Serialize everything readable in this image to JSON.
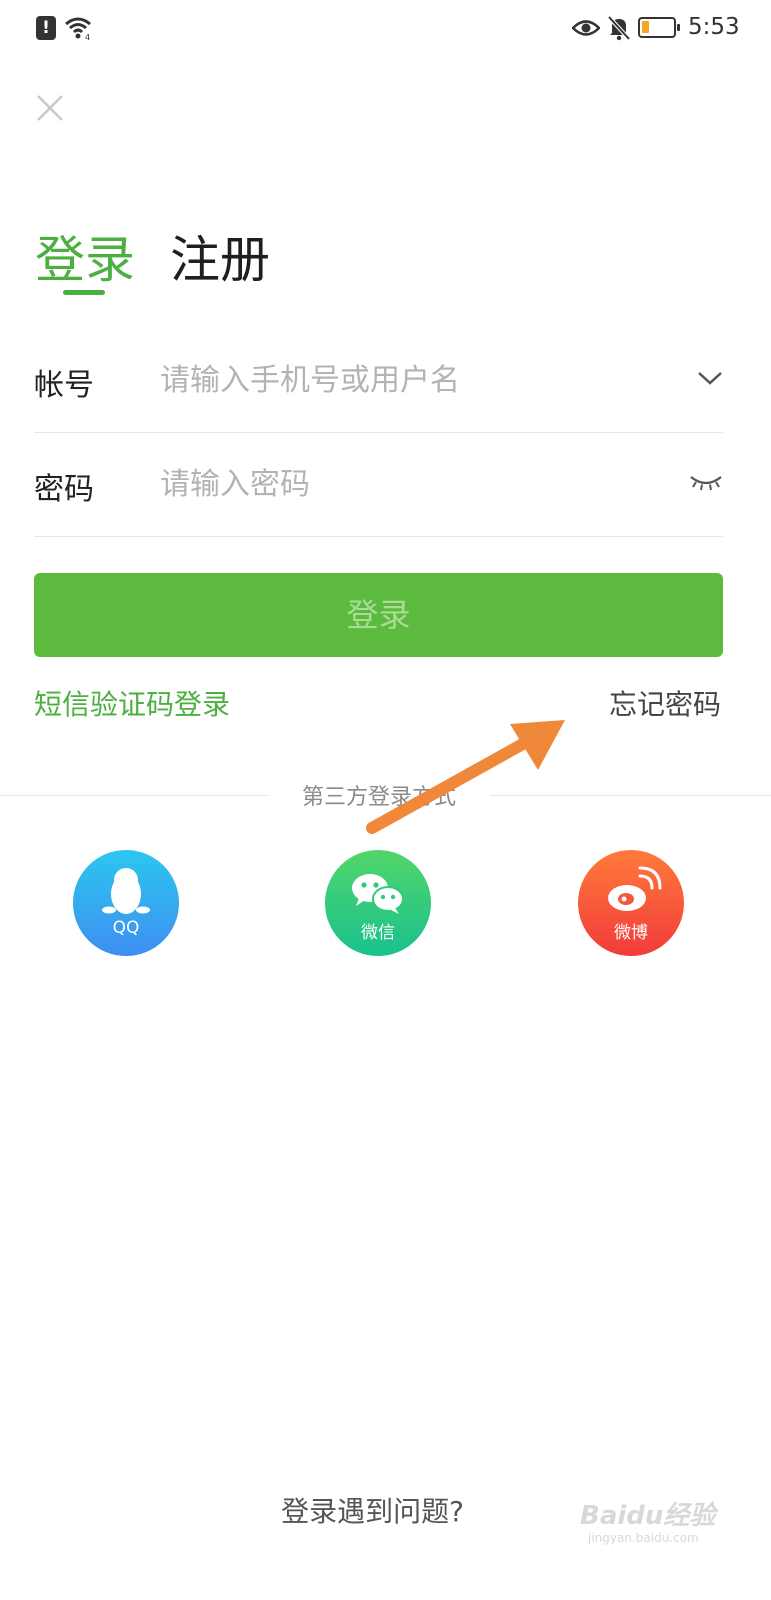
{
  "status_bar": {
    "time": "5:53",
    "icons": [
      "alert-icon",
      "wifi-icon",
      "eye-icon",
      "bell-muted-icon",
      "battery-icon"
    ],
    "battery_color": "#f5a623"
  },
  "header": {
    "close_icon": "close-icon"
  },
  "tabs": [
    {
      "label": "登录",
      "active": true
    },
    {
      "label": "注册",
      "active": false
    }
  ],
  "form": {
    "account": {
      "label": "帐号",
      "placeholder": "请输入手机号或用户名",
      "value": "",
      "icon": "chevron-down-icon"
    },
    "password": {
      "label": "密码",
      "placeholder": "请输入密码",
      "value": "",
      "icon": "eye-closed-icon"
    },
    "submit_label": "登录",
    "sms_login_label": "短信验证码登录",
    "forgot_password_label": "忘记密码"
  },
  "third_party": {
    "title": "第三方登录方式",
    "providers": [
      {
        "label": "QQ",
        "icon": "qq-penguin-icon"
      },
      {
        "label": "微信",
        "icon": "wechat-icon"
      },
      {
        "label": "微博",
        "icon": "weibo-icon"
      }
    ]
  },
  "footer": {
    "help_label": "登录遇到问题?",
    "watermark_text": "Baidu经验",
    "watermark_url": "jingyan.baidu.com"
  },
  "colors": {
    "accent": "#4caf42",
    "button_bg": "#5cba3f",
    "button_text": "#a9dc95",
    "annotation_arrow": "#f0883a"
  }
}
